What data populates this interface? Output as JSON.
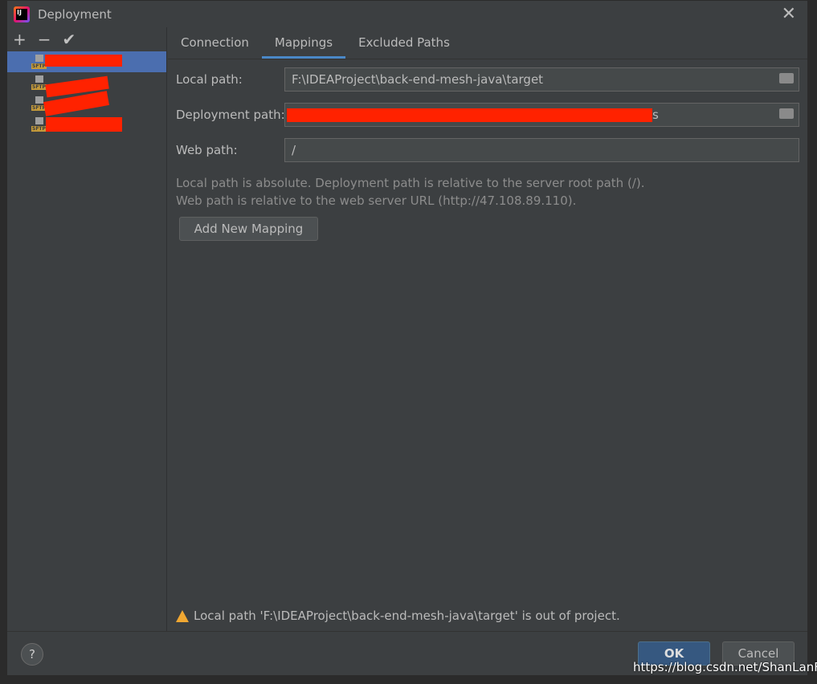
{
  "window": {
    "title": "Deployment",
    "close_icon": "close-icon"
  },
  "toolbar": {
    "add": "+",
    "remove": "−",
    "apply": "✔"
  },
  "servers": [
    {
      "type": "SFTP",
      "selected": true
    },
    {
      "type": "SFTP"
    },
    {
      "type": "SFTP"
    },
    {
      "type": "SFTP"
    }
  ],
  "tabs": [
    "Connection",
    "Mappings",
    "Excluded Paths"
  ],
  "active_tab": "Mappings",
  "form": {
    "local_path_label": "Local path:",
    "local_path": "F:\\IDEAProject\\back-end-mesh-java\\target",
    "deployment_path_label": "Deployment path:",
    "deployment_path_tail": "s",
    "web_path_label": "Web path:",
    "web_path": "/"
  },
  "help": [
    "Local path is absolute. Deployment path is relative to the server root path (/).",
    "Web path is relative to the web server URL (http://47.108.89.110)."
  ],
  "add_mapping": "Add New Mapping",
  "warning": "Local path 'F:\\IDEAProject\\back-end-mesh-java\\target' is out of project.",
  "footer": {
    "help": "?",
    "ok": "OK",
    "cancel": "Cancel"
  },
  "watermark": "https://blog.csdn.net/ShanLanF",
  "colors": {
    "accent": "#4b6eaf",
    "ok": "#365880",
    "warning": "#f0a732",
    "redaction": "#ff2200"
  }
}
